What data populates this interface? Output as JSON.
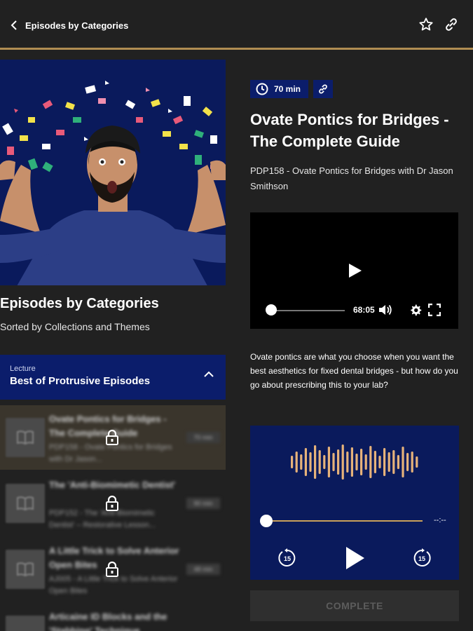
{
  "header": {
    "title": "Episodes by Categories",
    "accent_color": "#c9a05a"
  },
  "left": {
    "section_title": "Episodes by Categories",
    "section_subtitle": "Sorted by Collections and Themes",
    "collection": {
      "kicker": "Lecture",
      "name": "Best of Protrusive Episodes"
    },
    "episodes": [
      {
        "title": "Ovate Pontics for Bridges - The Complete Guide",
        "desc": "PDP158 - Ovate Pontics for Bridges with Dr Jason...",
        "duration": "70 min"
      },
      {
        "title": "The 'Anti-Biomimetic Dentist'",
        "desc": "PDP152 - The 'Anti-Biomimetic Dentist' – Restorative Lesson...",
        "duration": "90 min"
      },
      {
        "title": "A Little Trick to Solve Anterior Open Bites",
        "desc": "AJ005 - A Little Trick to Solve Anterior Open Bites",
        "duration": "48 min"
      },
      {
        "title": "Articaine ID Blocks and the 'Stabbing' Technique",
        "desc": "",
        "duration": ""
      }
    ]
  },
  "episode": {
    "duration": "70 min",
    "title": "Ovate Pontics for Bridges - The Complete Guide",
    "subtitle": "PDP158 - Ovate Pontics for Bridges with Dr Jason Smithson",
    "description": "Ovate pontics are what you choose when you want the best aesthetics for fixed dental bridges - but how do you go about prescribing this to your lab?",
    "video": {
      "time": "68:05"
    },
    "audio": {
      "time": "--:--",
      "skip_back": "15",
      "skip_forward": "15"
    },
    "complete_label": "COMPLETE"
  }
}
